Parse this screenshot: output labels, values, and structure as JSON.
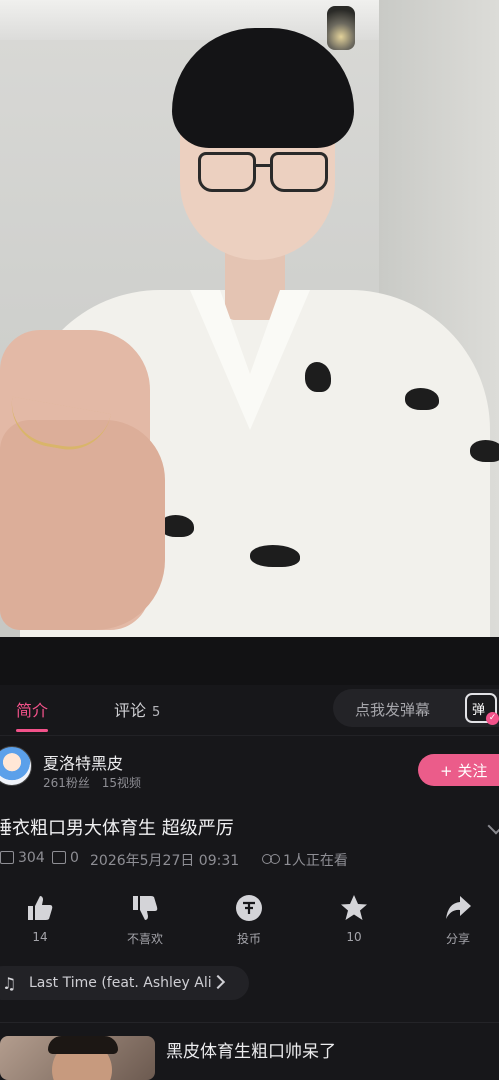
{
  "tabs": {
    "intro": "简介",
    "comments": "评论",
    "comments_count": "5"
  },
  "danmaku": {
    "placeholder": "点我发弹幕",
    "toggle": "弹"
  },
  "uploader": {
    "name": "夏洛特黑皮",
    "followers": "261粉丝",
    "videos": "15视频",
    "follow_button": "+ 关注"
  },
  "video": {
    "title": "睡衣粗口男大体育生 超级严厉",
    "views": "304",
    "danmaku_count": "0",
    "date": "2026年5月27日 09:31",
    "watching": "1人正在看"
  },
  "actions": [
    {
      "icon": "thumbs-up-icon",
      "label": "14"
    },
    {
      "icon": "thumbs-down-icon",
      "label": "不喜欢"
    },
    {
      "icon": "coin-icon",
      "label": "投币"
    },
    {
      "icon": "star-icon",
      "label": "10"
    },
    {
      "icon": "share-icon",
      "label": "分享"
    }
  ],
  "music": {
    "title": "Last Time (feat. Ashley Alisha)"
  },
  "recommendation": {
    "title": "黑皮体育生粗口帅呆了"
  },
  "colors": {
    "accent": "#f2528a",
    "background": "#17171a"
  }
}
